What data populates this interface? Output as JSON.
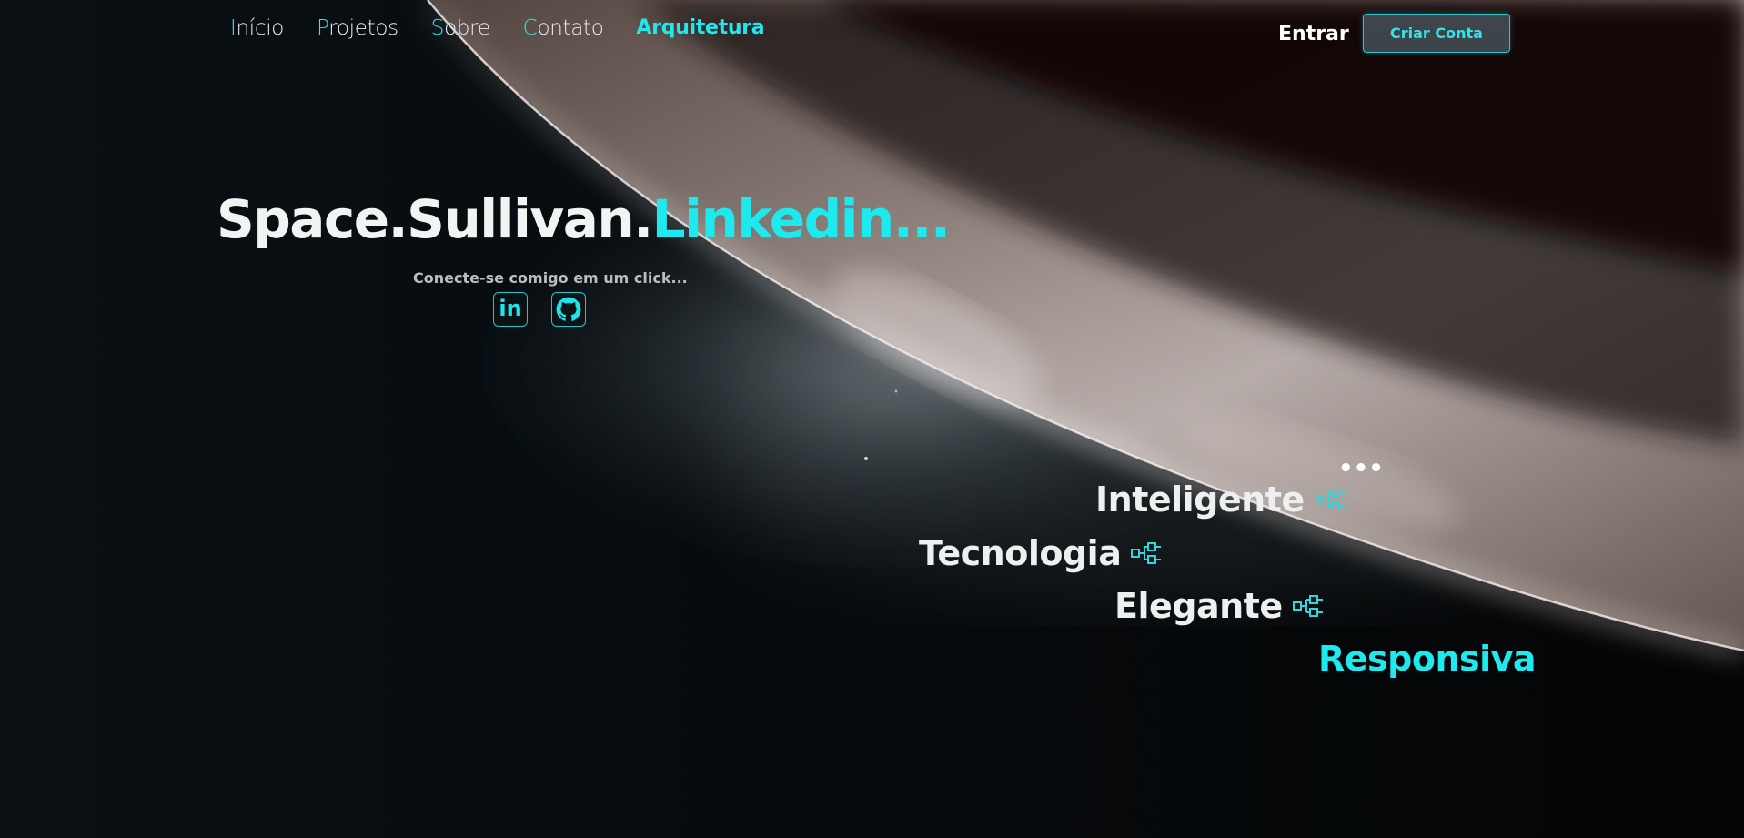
{
  "nav": {
    "items": [
      {
        "first": "I",
        "rest": "nício"
      },
      {
        "first": "P",
        "rest": "rojetos"
      },
      {
        "first": "S",
        "rest": "obre"
      },
      {
        "first": "C",
        "rest": "ontato"
      }
    ],
    "active": "Arquitetura"
  },
  "auth": {
    "login": "Entrar",
    "signup": "Criar Conta"
  },
  "hero": {
    "title_white": "Space.Sullivan.",
    "title_cyan": "Linkedin...",
    "subtitle": "Conecte-se comigo em um click...",
    "linkedin_icon": "in"
  },
  "icons": {
    "linkedin": "linkedin-icon",
    "github": "github-icon",
    "diagram": "diagram-icon"
  },
  "features": {
    "ellipsis": "•••",
    "items": [
      "Inteligente",
      "Tecnologia",
      "Elegante",
      "Responsiva"
    ]
  },
  "colors": {
    "accent": "#1ee9ef",
    "text": "#eef0f0",
    "background": "#040608"
  }
}
